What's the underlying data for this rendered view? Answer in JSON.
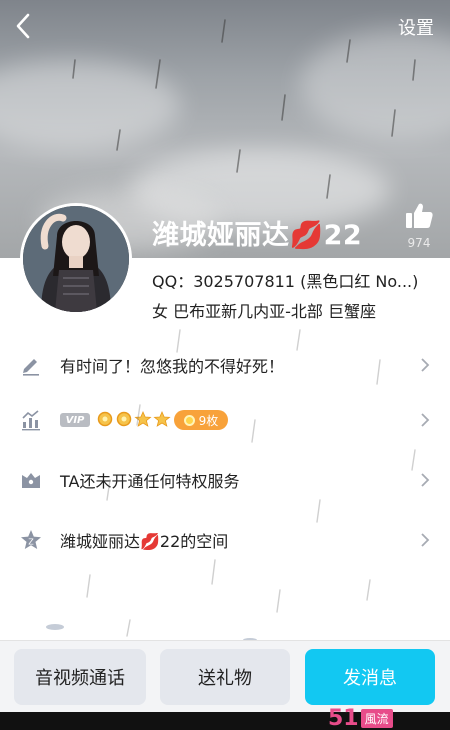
{
  "header": {
    "back_icon": "back-arrow-icon",
    "settings_label": "设置",
    "name": "潍城娅丽达💋22",
    "like_icon": "thumbs-up-icon",
    "like_count": "974"
  },
  "profile": {
    "qq": "QQ：3025707811 (黑色口红 No...)",
    "location": "女  巴布亚新几内亚-北部  巨蟹座"
  },
  "rows": [
    {
      "icon": "pencil-icon",
      "text": "有时间了！忽悠我的不得好死！"
    },
    {
      "icon": "level-chart-icon",
      "vip_label": "VIP",
      "coins": "9枚",
      "crown_icon": "crown-icon",
      "star_icon": "star-icon",
      "coin_icon": "coin-icon"
    },
    {
      "icon": "privilege-icon",
      "text": "TA还未开通任何特权服务"
    },
    {
      "icon": "space-star-icon",
      "text": "潍城娅丽达💋22的空间"
    }
  ],
  "bottom": {
    "call_label": "音视频通话",
    "gift_label": "送礼物",
    "message_label": "发消息"
  },
  "watermark": {
    "number": "51",
    "word": "風流"
  },
  "colors": {
    "accent": "#12c8f2",
    "coin": "#f8a23a",
    "watermark": "#e84c8a"
  }
}
